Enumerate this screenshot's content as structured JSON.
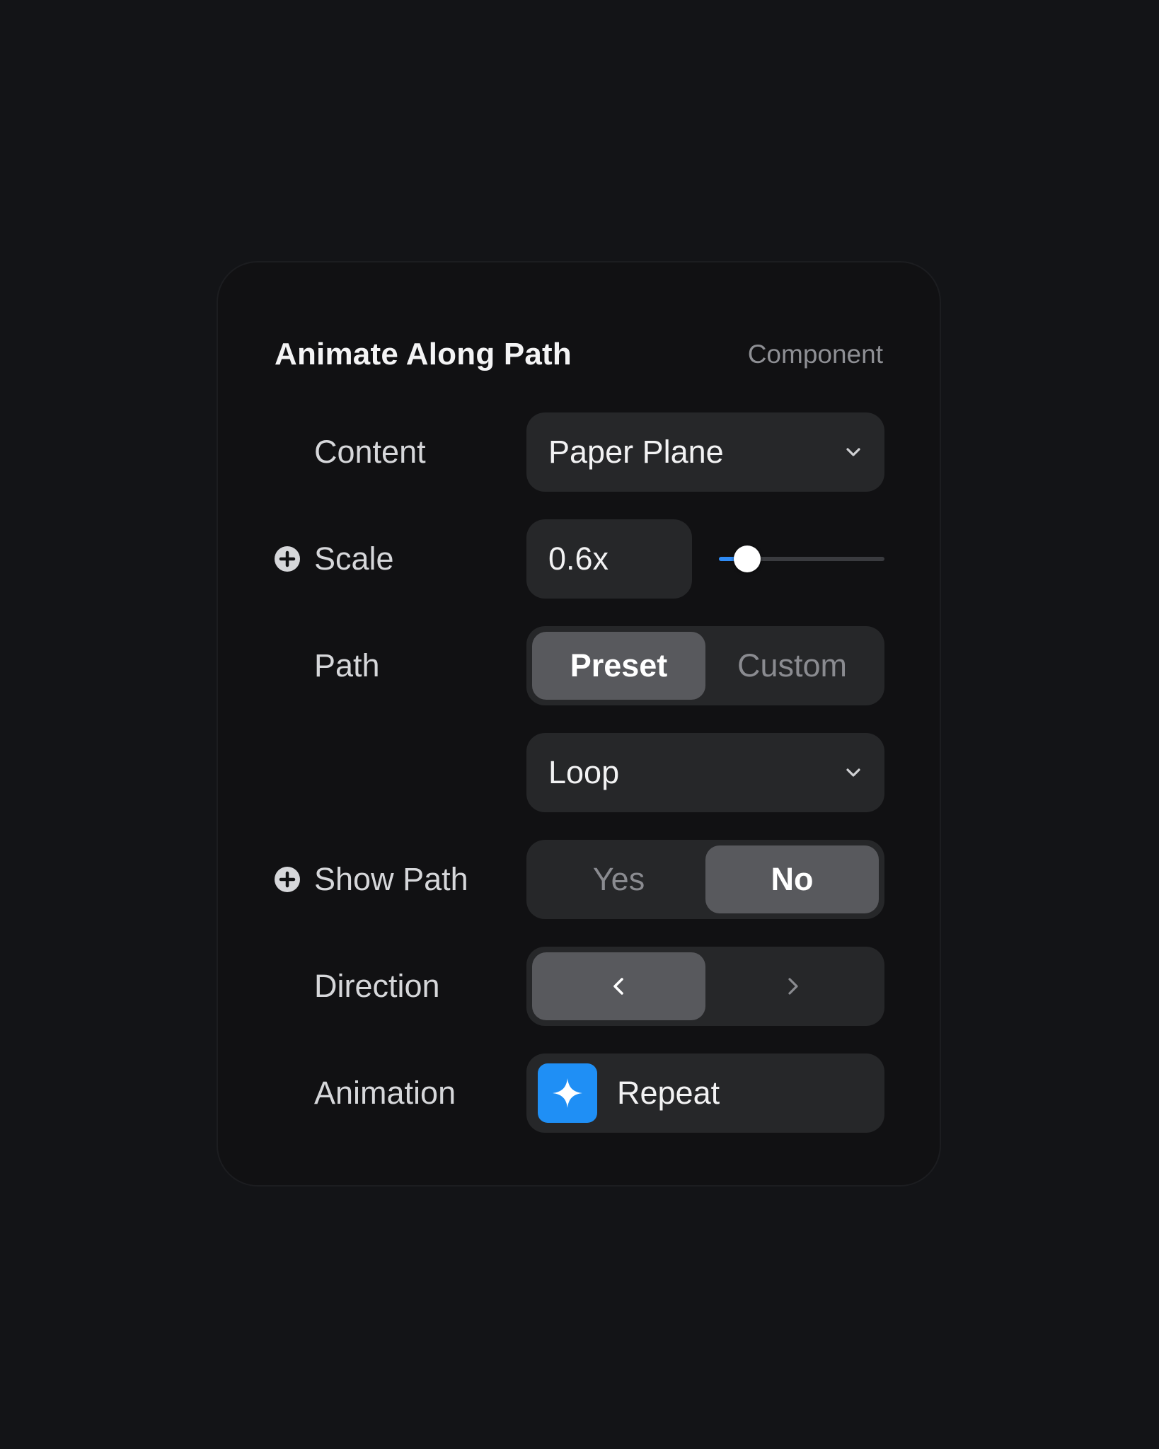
{
  "panel": {
    "title": "Animate Along Path",
    "kind": "Component"
  },
  "content": {
    "label": "Content",
    "value": "Paper Plane",
    "icon": "chevron-down-icon"
  },
  "scale": {
    "label": "Scale",
    "value": "0.6x",
    "slider_fraction": 0.17,
    "icon": "plus-circle-icon"
  },
  "path": {
    "label": "Path",
    "options": [
      "Preset",
      "Custom"
    ],
    "selected": "Preset",
    "preset_value": "Loop"
  },
  "show_path": {
    "label": "Show Path",
    "options": [
      "Yes",
      "No"
    ],
    "selected": "No",
    "icon": "plus-circle-icon"
  },
  "direction": {
    "label": "Direction",
    "options": [
      "chevron-left-icon",
      "chevron-right-icon"
    ],
    "selected": "chevron-left-icon"
  },
  "animation": {
    "label": "Animation",
    "value": "Repeat",
    "icon": "sparkle-icon",
    "icon_color": "#1f8ff5"
  },
  "colors": {
    "accent": "#2f8bf5",
    "background": "#131417",
    "panel": "#111113",
    "control": "#262729",
    "active_segment": "#58595d"
  }
}
